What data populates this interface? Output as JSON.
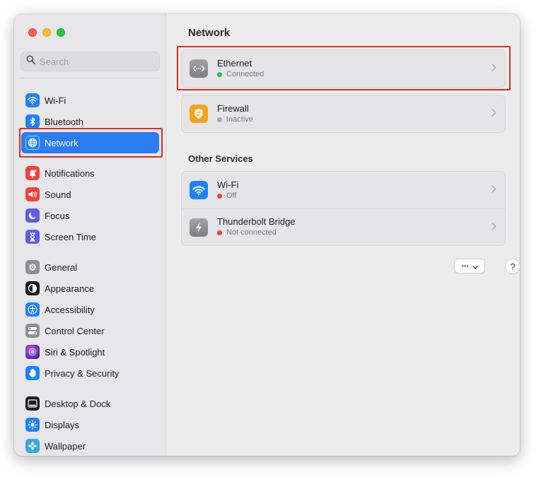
{
  "sidebar": {
    "search": {
      "placeholder": "Search",
      "value": ""
    },
    "groups": [
      [
        {
          "label": "Wi-Fi",
          "icon": "wifi-icon",
          "color": "#1a82fb"
        },
        {
          "label": "Bluetooth",
          "icon": "bluetooth-icon",
          "color": "#1a82fb"
        },
        {
          "label": "Network",
          "icon": "globe-icon",
          "color": "#1a82fb",
          "selected": true
        }
      ],
      [
        {
          "label": "Notifications",
          "icon": "bell-icon",
          "color": "#f2423c"
        },
        {
          "label": "Sound",
          "icon": "speaker-icon",
          "color": "#f2423c"
        },
        {
          "label": "Focus",
          "icon": "moon-icon",
          "color": "#5e5ce6"
        },
        {
          "label": "Screen Time",
          "icon": "hourglass-icon",
          "color": "#5e5ce6"
        }
      ],
      [
        {
          "label": "General",
          "icon": "gear-icon",
          "color": "#8e8e93"
        },
        {
          "label": "Appearance",
          "icon": "appearance-icon",
          "color": "#1c1c1e"
        },
        {
          "label": "Accessibility",
          "icon": "accessibility-icon",
          "color": "#1a82fb"
        },
        {
          "label": "Control Center",
          "icon": "control-center-icon",
          "color": "#8e8e93"
        },
        {
          "label": "Siri & Spotlight",
          "icon": "siri-icon",
          "color": "#7a3fd1"
        },
        {
          "label": "Privacy & Security",
          "icon": "hand-icon",
          "color": "#1a82fb"
        }
      ],
      [
        {
          "label": "Desktop & Dock",
          "icon": "dock-icon",
          "color": "#1c1c1e"
        },
        {
          "label": "Displays",
          "icon": "sun-icon",
          "color": "#1a82fb"
        },
        {
          "label": "Wallpaper",
          "icon": "wallpaper-icon",
          "color": "#34aadc"
        }
      ]
    ]
  },
  "main": {
    "title": "Network",
    "services": [
      {
        "name": "Ethernet",
        "status": "Connected",
        "status_color": "#28c840",
        "icon": "ethernet-icon",
        "icon_color": "#8e8e93"
      },
      {
        "name": "Firewall",
        "status": "Inactive",
        "status_color": "#a9a8ab",
        "icon": "firewall-icon",
        "icon_color": "#f7a21b"
      }
    ],
    "other_title": "Other Services",
    "other_services": [
      {
        "name": "Wi-Fi",
        "status": "Off",
        "status_color": "#ff3b30",
        "icon": "wifi-icon",
        "icon_color": "#1a82fb"
      },
      {
        "name": "Thunderbolt Bridge",
        "status": "Not connected",
        "status_color": "#ff3b30",
        "icon": "thunderbolt-icon",
        "icon_color": "#8e8e93"
      }
    ],
    "more_label": "···",
    "help_label": "?"
  },
  "colors": {
    "accent": "#2b7cf0",
    "highlight": "#d8301e"
  }
}
